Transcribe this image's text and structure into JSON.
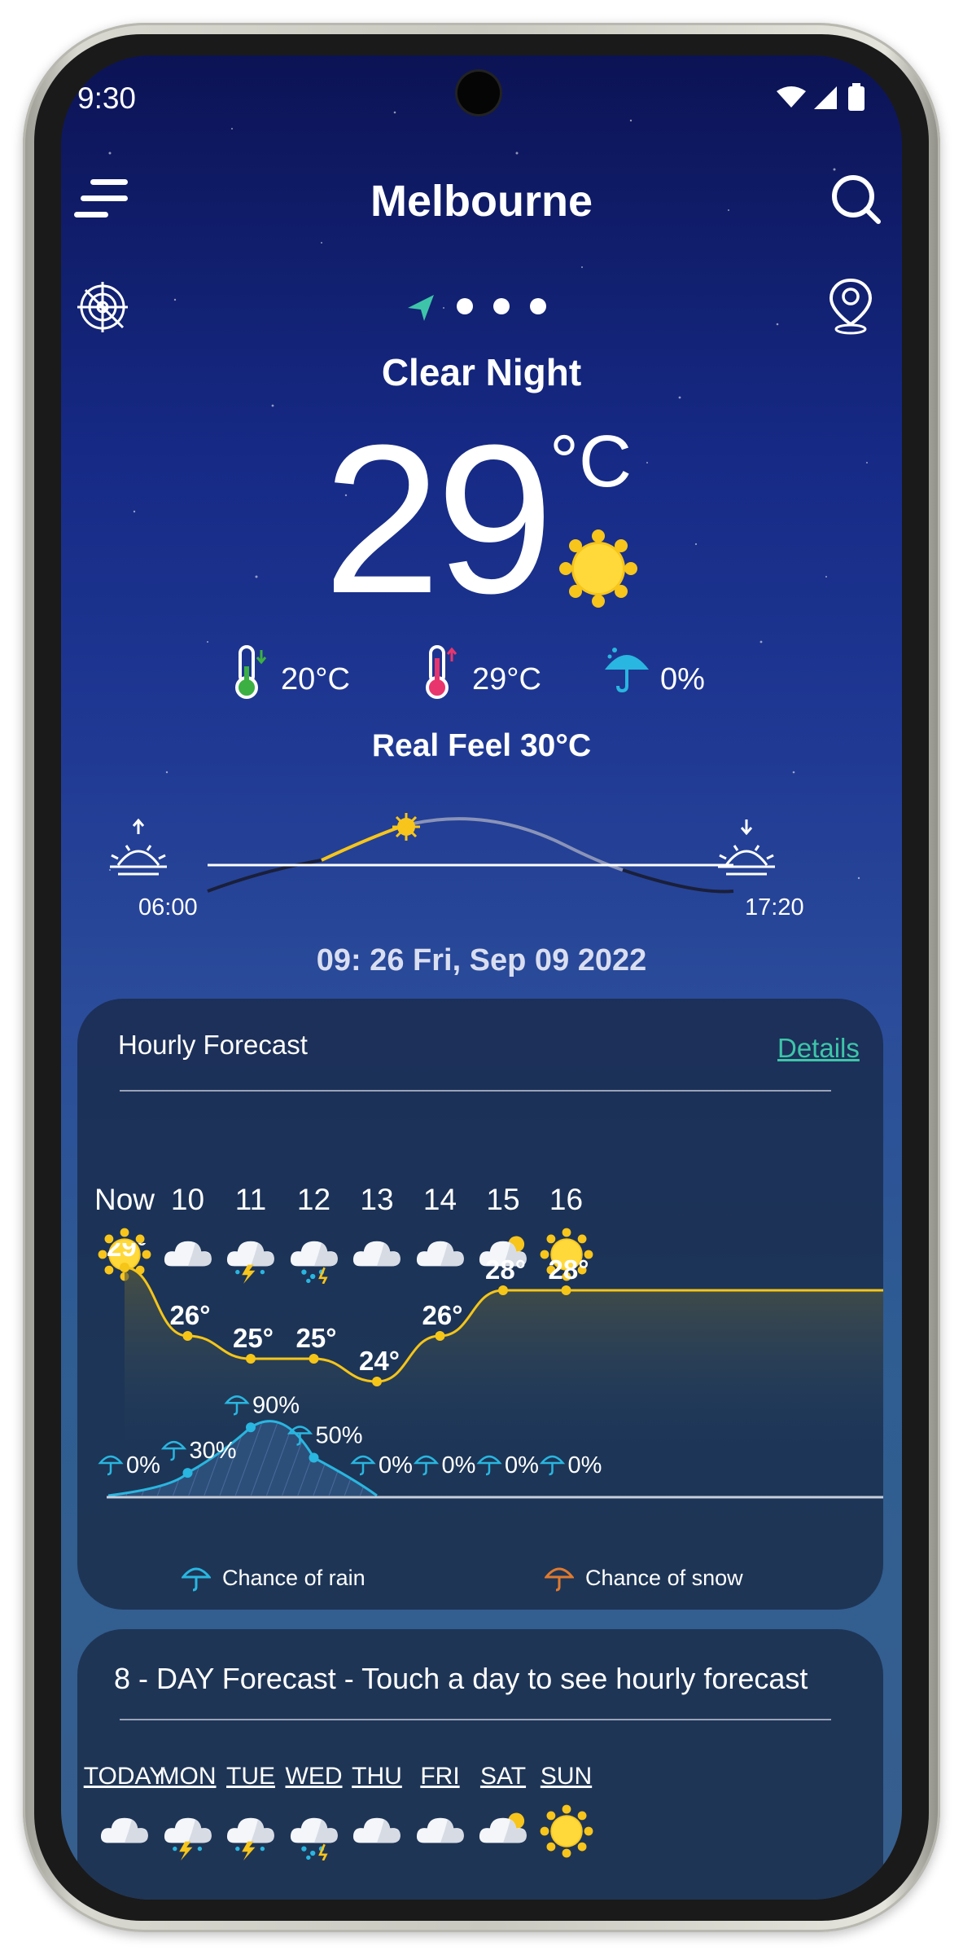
{
  "status_bar": {
    "time": "9:30"
  },
  "header": {
    "city": "Melbourne"
  },
  "current": {
    "condition": "Clear Night",
    "temperature": "29",
    "unit": "°C",
    "min_temp": "20°C",
    "max_temp": "29°C",
    "precip_chance": "0%",
    "real_feel": "Real Feel 30°C",
    "sunrise": "06:00",
    "sunset": "17:20",
    "datetime": "09: 26 Fri, Sep 09 2022",
    "sun_progress": 0.32
  },
  "hourly": {
    "title": "Hourly Forecast",
    "details_label": "Details",
    "hours": [
      {
        "label": "Now",
        "icon": "sun-icon",
        "temp": "29°",
        "rain": "0%"
      },
      {
        "label": "10",
        "icon": "cloud-icon",
        "temp": "26°",
        "rain": "30%"
      },
      {
        "label": "11",
        "icon": "thunderstorm-icon",
        "temp": "25°",
        "rain": "90%"
      },
      {
        "label": "12",
        "icon": "rain-cloud-icon",
        "temp": "25°",
        "rain": "50%"
      },
      {
        "label": "13",
        "icon": "cloud-icon",
        "temp": "24°",
        "rain": "0%"
      },
      {
        "label": "14",
        "icon": "cloud-icon",
        "temp": "26°",
        "rain": "0%"
      },
      {
        "label": "15",
        "icon": "partly-cloudy-icon",
        "temp": "28°",
        "rain": "0%"
      },
      {
        "label": "16",
        "icon": "sun-icon",
        "temp": "28°",
        "rain": "0%"
      }
    ],
    "legend_rain": "Chance of rain",
    "legend_snow": "Chance of snow",
    "colors": {
      "temp_line": "#f5c518",
      "rain_line": "#29b6e0",
      "snow": "#e07a2e"
    }
  },
  "daily": {
    "title": "8 - DAY Forecast - Touch a day to see hourly forecast",
    "days": [
      {
        "label": "TODAY",
        "icon": "cloud-icon"
      },
      {
        "label": "MON",
        "icon": "thunderstorm-icon"
      },
      {
        "label": "TUE",
        "icon": "thunderstorm-icon"
      },
      {
        "label": "WED",
        "icon": "rain-cloud-icon"
      },
      {
        "label": "THU",
        "icon": "cloud-icon"
      },
      {
        "label": "FRI",
        "icon": "cloud-icon"
      },
      {
        "label": "SAT",
        "icon": "partly-cloudy-icon"
      },
      {
        "label": "SUN",
        "icon": "sun-icon"
      }
    ]
  }
}
